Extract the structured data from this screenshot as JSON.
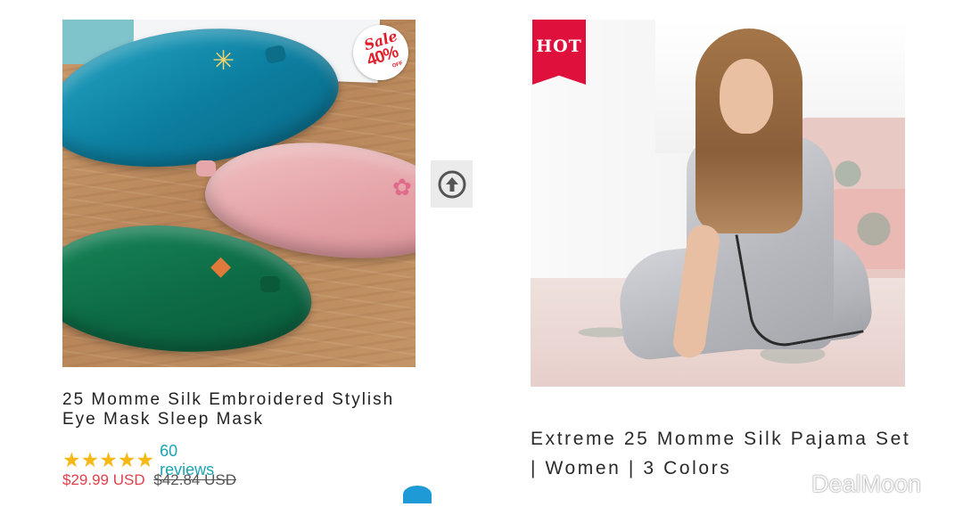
{
  "left_product": {
    "image_alt": "Silk eye masks in teal, pink and green on wood",
    "sale_badge": {
      "word": "Sale",
      "percent": "40%",
      "off": "OFF"
    },
    "title": "25 Momme Silk Embroidered Stylish Eye Mask Sleep Mask",
    "rating": {
      "stars": 5,
      "max_stars": 5,
      "reviews_label": "60 reviews"
    },
    "price": "$29.99 USD",
    "compare_price": "$42.84 USD"
  },
  "scroll_up_button": {
    "icon": "arrow-up-circle-icon"
  },
  "right_product": {
    "image_alt": "Woman in silver silk pajama set on a floral bed",
    "badge": "HOT",
    "title": "Extreme 25 Momme Silk Pajama Set | Women | 3 Colors"
  },
  "watermark": "DealMoon",
  "colors": {
    "sale_red": "#e0404a",
    "badge_red": "#e0103d",
    "review_link": "#1aa3b3",
    "star": "#f5b815",
    "text_dark": "#222222"
  }
}
